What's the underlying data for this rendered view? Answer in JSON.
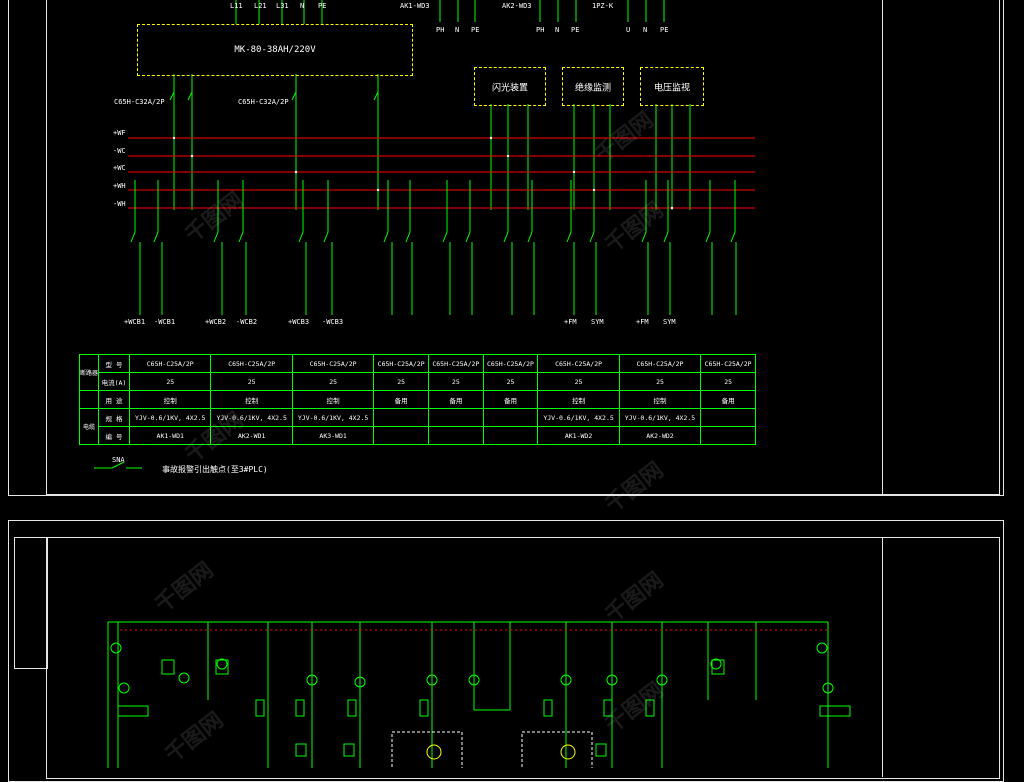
{
  "top_labels": {
    "phases": [
      "L11",
      "L21",
      "L31",
      "N",
      "PE"
    ],
    "ak1": "AK1-WD3",
    "ak2": "AK2-WD3",
    "ak3": "1PZ-K",
    "mid_terms": [
      "PH",
      "N",
      "PE"
    ],
    "mid_terms2": [
      "PH",
      "N",
      "PE"
    ],
    "right_terms": [
      "U",
      "N",
      "PE"
    ]
  },
  "power_box": "MK-80-38AH/220V",
  "yellow_boxes": [
    "闪光装置",
    "绝缘监测",
    "电压监视"
  ],
  "breakers": [
    "C65H-C32A/2P",
    "C65H-C32A/2P"
  ],
  "buses": [
    "+WF",
    "-WC",
    "+WC",
    "+WH",
    "-WH"
  ],
  "bottom_terms": [
    "+WCB1",
    "-WCB1",
    "+WCB2",
    "-WCB2",
    "+WCB3",
    "-WCB3",
    "+FM",
    "SYM",
    "+FM",
    "SYM"
  ],
  "table": {
    "header_side": [
      "断路器",
      "电缆"
    ],
    "row_labels": [
      "型 号",
      "电流(A)",
      "用 途",
      "规 格",
      "编 号"
    ],
    "models": [
      "C65H-C25A/2P",
      "C65H-C25A/2P",
      "C65H-C25A/2P",
      "C65H-C25A/2P",
      "C65H-C25A/2P",
      "C65H-C25A/2P",
      "C65H-C25A/2P",
      "C65H-C25A/2P",
      "C65H-C25A/2P"
    ],
    "currents": [
      "25",
      "25",
      "25",
      "25",
      "25",
      "25",
      "25",
      "25",
      "25"
    ],
    "uses": [
      "控制",
      "控制",
      "控制",
      "备用",
      "备用",
      "备用",
      "控制",
      "控制",
      "备用"
    ],
    "specs": [
      "YJV-0.6/1KV, 4X2.5",
      "YJV-0.6/1KV, 4X2.5",
      "YJV-0.6/1KV, 4X2.5",
      "",
      "",
      "",
      "YJV-0.6/1KV, 4X2.5",
      "YJV-0.6/1KV, 4X2.5",
      ""
    ],
    "numbers": [
      "AK1-WD1",
      "AK2-WD1",
      "AK3-WD1",
      "",
      "",
      "",
      "AK1-WD2",
      "AK2-WD2",
      ""
    ]
  },
  "sna": "SNA",
  "note": "事故报警引出触点(至3#PLC)",
  "watermark": "千图网",
  "colors": {
    "bus": "#ff0000",
    "wire": "#00ff00",
    "frame": "#e6e6e6",
    "dash": "#ffff00"
  }
}
